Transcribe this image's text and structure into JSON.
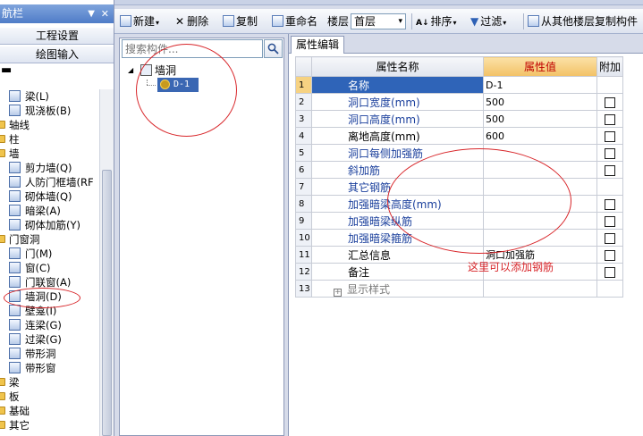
{
  "nav": {
    "title": "航栏",
    "pin_icon": "▼",
    "close_icon": "✕",
    "buttons": [
      "工程设置",
      "绘图输入"
    ],
    "tree_separator": "▬",
    "items": [
      {
        "label": "梁(L)",
        "level": 1,
        "icon": "beam-icon"
      },
      {
        "label": "现浇板(B)",
        "level": 1,
        "icon": "slab-icon"
      },
      {
        "label": "轴线",
        "level": 0,
        "icon": "folder-icon"
      },
      {
        "label": "柱",
        "level": 0,
        "icon": "folder-icon"
      },
      {
        "label": "墙",
        "level": 0,
        "icon": "folder-icon"
      },
      {
        "label": "剪力墙(Q)",
        "level": 1,
        "icon": "shear-wall-icon"
      },
      {
        "label": "人防门框墙(RF",
        "level": 1,
        "icon": "civil-defense-wall-icon"
      },
      {
        "label": "砌体墙(Q)",
        "level": 1,
        "icon": "masonry-wall-icon"
      },
      {
        "label": "暗梁(A)",
        "level": 1,
        "icon": "hidden-beam-icon"
      },
      {
        "label": "砌体加筋(Y)",
        "level": 1,
        "icon": "masonry-rebar-icon"
      },
      {
        "label": "门窗洞",
        "level": 0,
        "icon": "folder-icon"
      },
      {
        "label": "门(M)",
        "level": 1,
        "icon": "door-icon"
      },
      {
        "label": "窗(C)",
        "level": 1,
        "icon": "window-icon"
      },
      {
        "label": "门联窗(A)",
        "level": 1,
        "icon": "door-window-icon"
      },
      {
        "label": "墙洞(D)",
        "level": 1,
        "icon": "wall-opening-icon"
      },
      {
        "label": "壁龛(I)",
        "level": 1,
        "icon": "niche-icon"
      },
      {
        "label": "连梁(G)",
        "level": 1,
        "icon": "coupling-beam-icon"
      },
      {
        "label": "过梁(G)",
        "level": 1,
        "icon": "lintel-icon"
      },
      {
        "label": "带形洞",
        "level": 1,
        "icon": "strip-opening-icon"
      },
      {
        "label": "带形窗",
        "level": 1,
        "icon": "strip-window-icon"
      },
      {
        "label": "梁",
        "level": 0,
        "icon": "folder-icon"
      },
      {
        "label": "板",
        "level": 0,
        "icon": "folder-icon"
      },
      {
        "label": "基础",
        "level": 0,
        "icon": "folder-icon"
      },
      {
        "label": "其它",
        "level": 0,
        "icon": "folder-icon"
      }
    ]
  },
  "toolbar": {
    "new_label": "新建",
    "delete_label": "删除",
    "copy_label": "复制",
    "rename_label": "重命名",
    "floor_label": "楼层",
    "floor_value": "首层",
    "sort_label": "排序",
    "filter_label": "过滤",
    "copy_from_floor_label": "从其他楼层复制构件",
    "caret": "▾",
    "delete_icon": "✕"
  },
  "list": {
    "search_placeholder": "搜索构件...",
    "root_label": "墙洞",
    "root_expander": "◢",
    "child_label": "D-1"
  },
  "props": {
    "tab_label": "属性编辑",
    "headers": {
      "name": "属性名称",
      "value": "属性值",
      "extra": "附加"
    },
    "rows": [
      {
        "num": "1",
        "name": "名称",
        "value": "D-1",
        "checkbox": false
      },
      {
        "num": "2",
        "name": "洞口宽度(mm)",
        "value": "500",
        "checkbox": true
      },
      {
        "num": "3",
        "name": "洞口高度(mm)",
        "value": "500",
        "checkbox": true
      },
      {
        "num": "4",
        "name": "离地高度(mm)",
        "value": "600",
        "checkbox": true
      },
      {
        "num": "5",
        "name": "洞口每侧加强筋",
        "value": "",
        "checkbox": true
      },
      {
        "num": "6",
        "name": "斜加筋",
        "value": "",
        "checkbox": true
      },
      {
        "num": "7",
        "name": "其它钢筋",
        "value": "",
        "checkbox": false
      },
      {
        "num": "8",
        "name": "加强暗梁高度(mm)",
        "value": "",
        "checkbox": true
      },
      {
        "num": "9",
        "name": "加强暗梁纵筋",
        "value": "",
        "checkbox": true
      },
      {
        "num": "10",
        "name": "加强暗梁箍筋",
        "value": "",
        "checkbox": true
      },
      {
        "num": "11",
        "name": "汇总信息",
        "value": "洞口加强筋",
        "checkbox": true
      },
      {
        "num": "12",
        "name": "备注",
        "value": "",
        "checkbox": true
      },
      {
        "num": "13",
        "name": "显示样式",
        "value": "",
        "checkbox": false
      }
    ],
    "expand_sign": "+"
  },
  "annotation": {
    "note": "这里可以添加钢筋",
    "color": "#d8262a"
  }
}
